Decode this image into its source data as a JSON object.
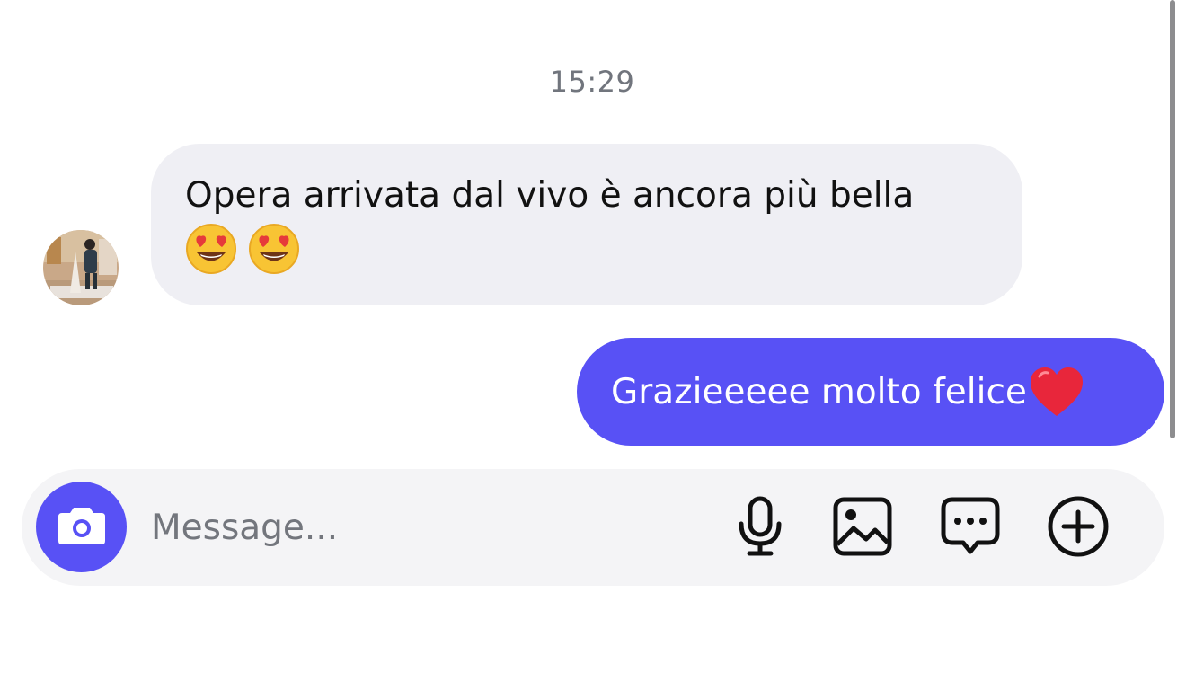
{
  "chat": {
    "timestamp": "15:29",
    "incoming": {
      "text": "Opera arrivata dal vivo è ancora più bella",
      "emojis": [
        "heart-eyes-emoji",
        "heart-eyes-emoji"
      ]
    },
    "outgoing": {
      "text": "Grazieeeee molto felice",
      "emoji": "red-heart-emoji"
    }
  },
  "composer": {
    "placeholder": "Message...",
    "icons": [
      "camera-icon",
      "microphone-icon",
      "gallery-icon",
      "chat-bubble-icon",
      "add-circle-icon"
    ]
  },
  "colors": {
    "accent": "#5851f5",
    "incoming_bubble": "#efeff4",
    "composer_bg": "#f4f4f6",
    "timestamp": "#71757d"
  }
}
